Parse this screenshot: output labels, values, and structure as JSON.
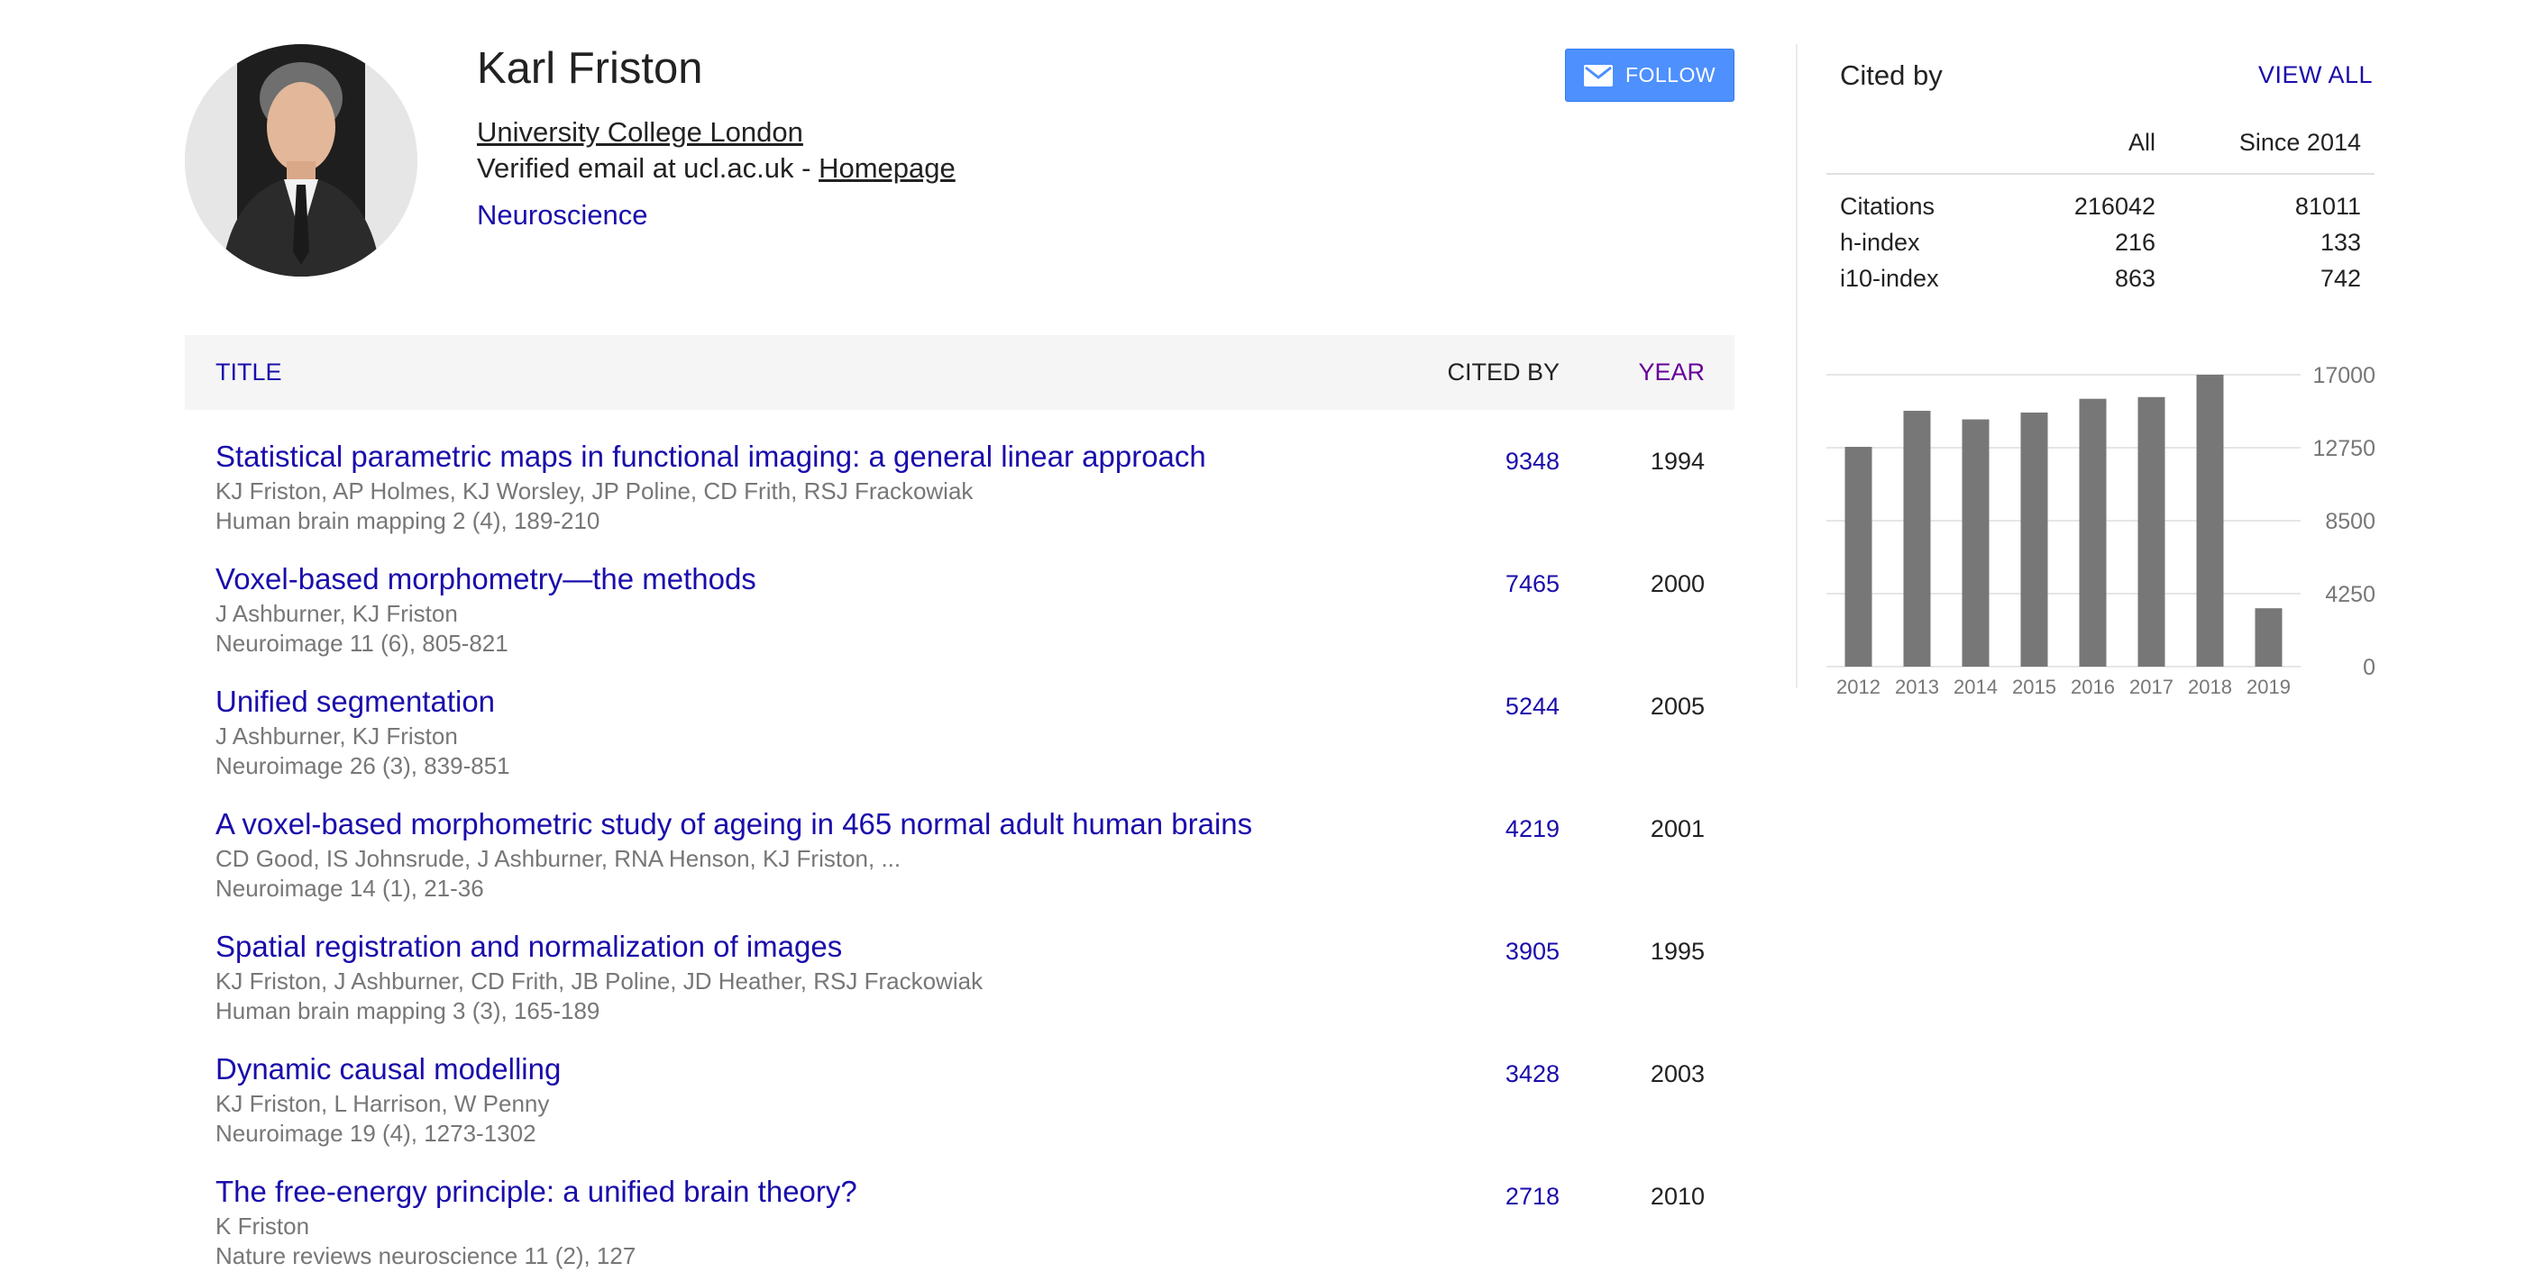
{
  "profile": {
    "name": "Karl Friston",
    "affiliation": "University College London",
    "email_prefix": "Verified email at ucl.ac.uk - ",
    "homepage_label": "Homepage",
    "interest": "Neuroscience",
    "follow_label": "FOLLOW"
  },
  "table": {
    "headers": {
      "title": "TITLE",
      "cited_by": "CITED BY",
      "year": "YEAR"
    },
    "rows": [
      {
        "title": "Statistical parametric maps in functional imaging: a general linear approach",
        "authors": "KJ Friston, AP Holmes, KJ Worsley, JP Poline, CD Frith, RSJ Frackowiak",
        "venue": "Human brain mapping 2 (4), 189-210",
        "cited": "9348",
        "year": "1994"
      },
      {
        "title": "Voxel-based morphometry—the methods",
        "authors": "J Ashburner, KJ Friston",
        "venue": "Neuroimage 11 (6), 805-821",
        "cited": "7465",
        "year": "2000"
      },
      {
        "title": "Unified segmentation",
        "authors": "J Ashburner, KJ Friston",
        "venue": "Neuroimage 26 (3), 839-851",
        "cited": "5244",
        "year": "2005"
      },
      {
        "title": "A voxel-based morphometric study of ageing in 465 normal adult human brains",
        "authors": "CD Good, IS Johnsrude, J Ashburner, RNA Henson, KJ Friston, ...",
        "venue": "Neuroimage 14 (1), 21-36",
        "cited": "4219",
        "year": "2001"
      },
      {
        "title": "Spatial registration and normalization of images",
        "authors": "KJ Friston, J Ashburner, CD Frith, JB Poline, JD Heather, RSJ Frackowiak",
        "venue": "Human brain mapping 3 (3), 165-189",
        "cited": "3905",
        "year": "1995"
      },
      {
        "title": "Dynamic causal modelling",
        "authors": "KJ Friston, L Harrison, W Penny",
        "venue": "Neuroimage 19 (4), 1273-1302",
        "cited": "3428",
        "year": "2003"
      },
      {
        "title": "The free-energy principle: a unified brain theory?",
        "authors": "K Friston",
        "venue": "Nature reviews neuroscience 11 (2), 127",
        "cited": "2718",
        "year": "2010"
      }
    ]
  },
  "cited_by": {
    "title": "Cited by",
    "view_all": "VIEW ALL",
    "col_all": "All",
    "col_since": "Since 2014",
    "stats": [
      {
        "label": "Citations",
        "all": "216042",
        "since": "81011"
      },
      {
        "label": "h-index",
        "all": "216",
        "since": "133"
      },
      {
        "label": "i10-index",
        "all": "863",
        "since": "742"
      }
    ]
  },
  "chart_data": {
    "type": "bar",
    "categories": [
      "2012",
      "2013",
      "2014",
      "2015",
      "2016",
      "2017",
      "2018",
      "2019"
    ],
    "values": [
      12800,
      14900,
      14400,
      14800,
      15600,
      15700,
      17000,
      3400
    ],
    "y_ticks": [
      "17000",
      "12750",
      "8500",
      "4250",
      "0"
    ],
    "ylim": [
      0,
      17000
    ],
    "bar_color": "#777777",
    "grid": true
  },
  "colors": {
    "link": "#1a0dab",
    "year_header": "#660099",
    "follow_button": "#4d90fe",
    "muted_text": "#777777"
  },
  "icons": {
    "follow": "envelope-icon"
  }
}
